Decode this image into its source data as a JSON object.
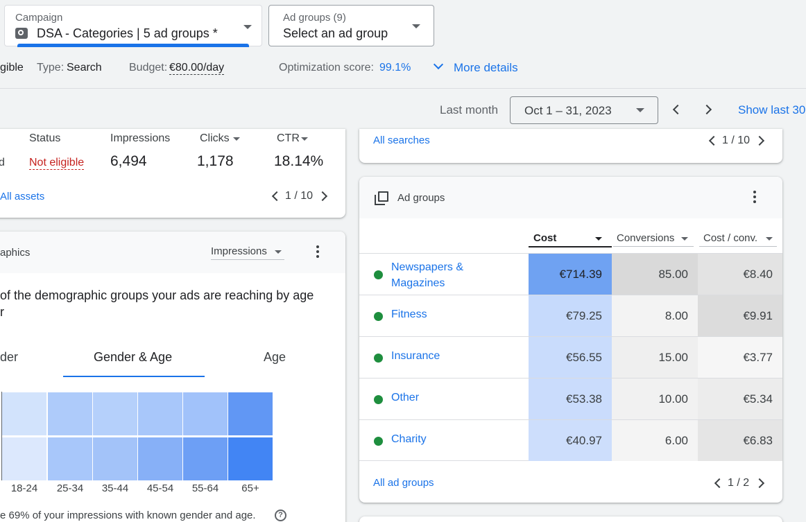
{
  "campaign": {
    "label": "Campaign",
    "value": "DSA - Categories | 5 ad groups *"
  },
  "ad_groups_select": {
    "label": "Ad groups (9)",
    "value": "Select an ad group"
  },
  "info": {
    "status_partial": "gible",
    "type_label": "Type:",
    "type_value": "Search",
    "budget_label": "Budget:",
    "budget_value": "€80.00/day",
    "opt_label": "Optimization score:",
    "opt_value": "99.1%",
    "more_details": "More details"
  },
  "date": {
    "label": "Last month",
    "range": "Oct 1 – 31, 2023",
    "show_last": "Show last 30"
  },
  "assets_card": {
    "headers": {
      "status": "Status",
      "impressions": "Impressions",
      "clicks": "Clicks",
      "ctr": "CTR"
    },
    "row": {
      "prefix": "d",
      "status": "Not eligible",
      "impressions": "6,494",
      "clicks": "1,178",
      "ctr": "18.14%"
    },
    "link": "All assets",
    "pagination": "1 / 10"
  },
  "searches_card": {
    "link": "All searches",
    "pagination": "1 / 10"
  },
  "demo_card": {
    "title": "aphics",
    "metric": "Impressions",
    "desc_line1": "of the demographic groups your ads are reaching by age",
    "desc_line2": "r",
    "tabs": [
      "der",
      "Gender & Age",
      "Age"
    ],
    "age_labels": [
      "18-24",
      "25-34",
      "35-44",
      "45-54",
      "55-64",
      "65+"
    ],
    "footer": "e 69% of your impressions with known gender and age."
  },
  "ad_groups_card": {
    "title": "Ad groups",
    "columns": {
      "cost": "Cost",
      "conversions": "Conversions",
      "cost_conv": "Cost / conv."
    },
    "rows": [
      {
        "name_line1": "Newspapers &",
        "name_line2": "Magazines",
        "cost": "€714.39",
        "conversions": "85.00",
        "cost_conv": "€8.40"
      },
      {
        "name_line1": "Fitness",
        "name_line2": "",
        "cost": "€79.25",
        "conversions": "8.00",
        "cost_conv": "€9.91"
      },
      {
        "name_line1": "Insurance",
        "name_line2": "",
        "cost": "€56.55",
        "conversions": "15.00",
        "cost_conv": "€3.77"
      },
      {
        "name_line1": "Other",
        "name_line2": "",
        "cost": "€53.38",
        "conversions": "10.00",
        "cost_conv": "€5.34"
      },
      {
        "name_line1": "Charity",
        "name_line2": "",
        "cost": "€40.97",
        "conversions": "6.00",
        "cost_conv": "€6.83"
      }
    ],
    "link": "All ad groups",
    "pagination": "1 / 2"
  },
  "colors": {
    "accent": "#1a73e8",
    "status_red": "#c5221f",
    "active_green": "#1e8e3e"
  }
}
